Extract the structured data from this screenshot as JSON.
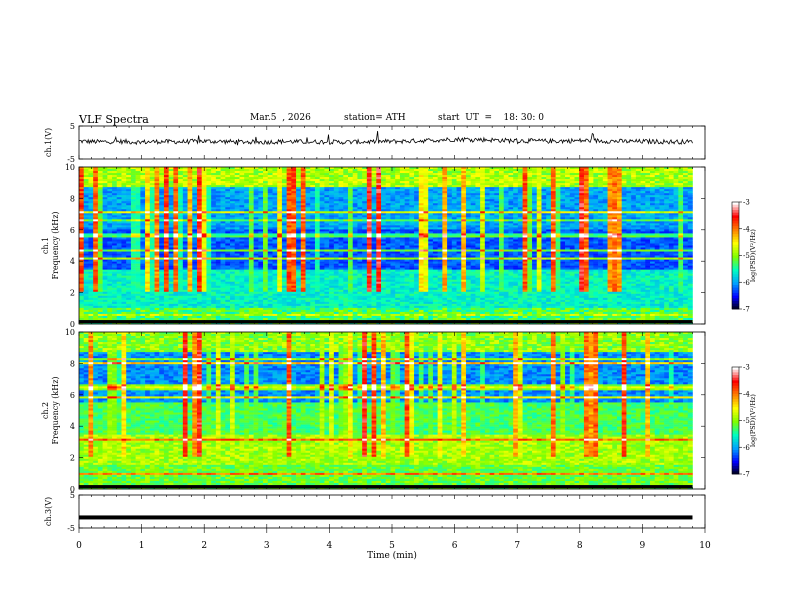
{
  "header": {
    "title": "VLF  Spectra",
    "date": "Mar.5  , 2026",
    "station": "station= ATH",
    "start": "start  UT  =    18: 30: 0"
  },
  "chart_data": [
    {
      "type": "line",
      "panel": "ch1-waveform",
      "ylabel": "ch.1(V)",
      "ylim": [
        -5,
        5
      ],
      "yticks": [
        "5",
        "-5"
      ],
      "xlim": [
        0,
        10
      ],
      "series": [
        {
          "values": [
            0.4,
            0.2,
            0.3,
            0.1,
            0.3,
            0.2,
            0.4,
            0.3,
            0.2,
            0.1,
            0.3,
            0.2,
            0.2,
            0.1,
            0.2,
            0.3,
            0.4,
            0.6,
            0.9,
            1.0,
            0.8,
            0.6,
            0.5,
            0.4,
            0.5,
            0.6,
            0.4,
            0.3,
            0.3,
            0.2,
            0.2
          ]
        }
      ],
      "color": "#000000"
    },
    {
      "type": "heatmap",
      "panel": "ch1-spectrogram",
      "ylabel": "ch.1\nFrequency  (kHz)",
      "ylim": [
        0,
        10
      ],
      "yticks": [
        "0",
        "2",
        "4",
        "6",
        "8",
        "10"
      ],
      "xlim": [
        0,
        10
      ],
      "colorbar": {
        "label": "log(PSD)(V²/Hz)",
        "range": [
          -7,
          -3
        ],
        "ticks": [
          "-3",
          "-4",
          "-5",
          "-6",
          "-7"
        ]
      }
    },
    {
      "type": "heatmap",
      "panel": "ch2-spectrogram",
      "ylabel": "ch.2\nFrequency  (kHz)",
      "ylim": [
        0,
        10
      ],
      "yticks": [
        "0",
        "2",
        "4",
        "6",
        "8",
        "10"
      ],
      "xlim": [
        0,
        10
      ],
      "colorbar": {
        "label": "log(PSD)(V²/Hz)",
        "range": [
          -7,
          -3
        ],
        "ticks": [
          "-3",
          "-4",
          "-5",
          "-6",
          "-7"
        ]
      }
    },
    {
      "type": "line",
      "panel": "ch3-waveform",
      "ylabel": "ch.3(V)",
      "ylim": [
        -5,
        5
      ],
      "yticks": [
        "5",
        "-5"
      ],
      "xlim": [
        0,
        10
      ],
      "series": [
        {
          "values": [
            -1.8,
            -1.8,
            -1.8,
            -1.8,
            -1.8,
            -1.8,
            -1.8,
            -1.8,
            -1.8,
            -1.8,
            -1.8
          ]
        }
      ],
      "color": "#000000"
    }
  ],
  "xaxis": {
    "label": "Time  (min)",
    "ticks": [
      "0",
      "1",
      "2",
      "3",
      "4",
      "5",
      "6",
      "7",
      "8",
      "9",
      "10"
    ]
  },
  "colors": {
    "colormap": [
      "#000000",
      "#0000ff",
      "#00a0ff",
      "#00ffc0",
      "#80ff00",
      "#ffff00",
      "#ff8000",
      "#ff0000",
      "#ffffff"
    ]
  }
}
